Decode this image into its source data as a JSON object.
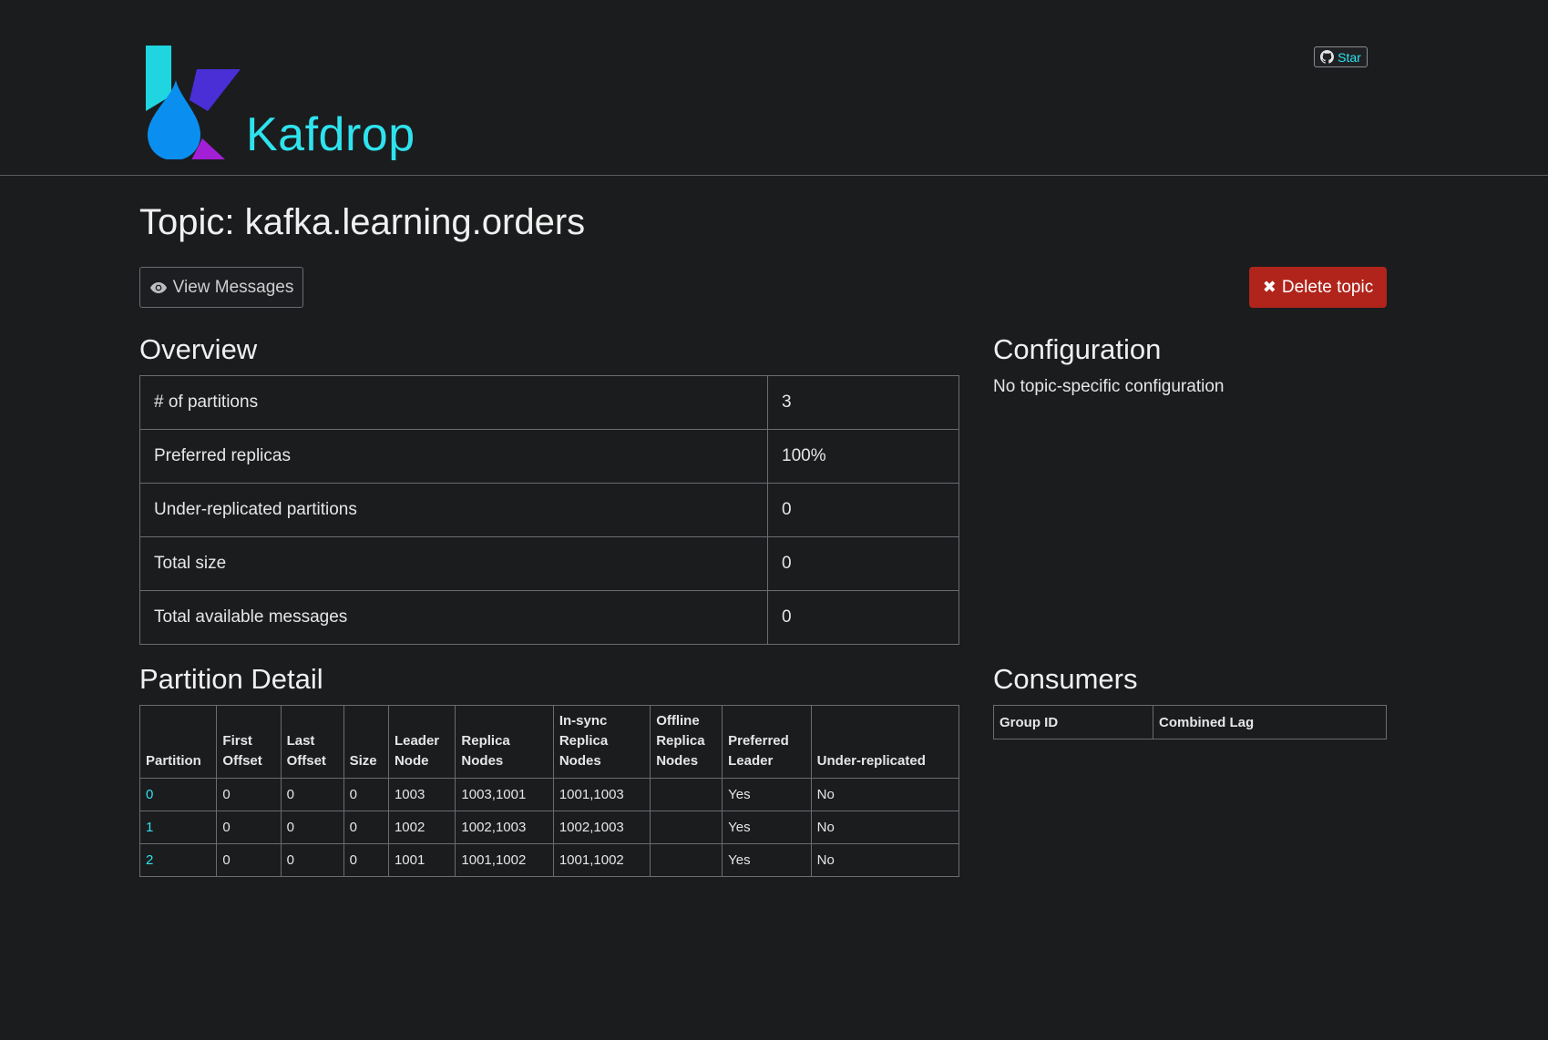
{
  "header": {
    "brand": "Kafdrop",
    "star_label": "Star"
  },
  "page": {
    "title": "Topic: kafka.learning.orders",
    "view_messages_label": "View Messages",
    "delete_topic_label": "Delete topic"
  },
  "overview": {
    "title": "Overview",
    "rows": [
      {
        "label": "# of partitions",
        "value": "3"
      },
      {
        "label": "Preferred replicas",
        "value": "100%"
      },
      {
        "label": "Under-replicated partitions",
        "value": "0"
      },
      {
        "label": "Total size",
        "value": "0"
      },
      {
        "label": "Total available messages",
        "value": "0"
      }
    ]
  },
  "configuration": {
    "title": "Configuration",
    "text": "No topic-specific configuration"
  },
  "partition_detail": {
    "title": "Partition Detail",
    "headers": [
      [
        "Partition"
      ],
      [
        "First",
        "Offset"
      ],
      [
        "Last",
        "Offset"
      ],
      [
        "Size"
      ],
      [
        "Leader",
        "Node"
      ],
      [
        "Replica",
        "Nodes"
      ],
      [
        "In-sync",
        "Replica",
        "Nodes"
      ],
      [
        "Offline",
        "Replica",
        "Nodes"
      ],
      [
        "Preferred",
        "Leader"
      ],
      [
        "Under-replicated"
      ]
    ],
    "rows": [
      [
        "0",
        "0",
        "0",
        "0",
        "1003",
        "1003,1001",
        "1001,1003",
        "",
        "Yes",
        "No"
      ],
      [
        "1",
        "0",
        "0",
        "0",
        "1002",
        "1002,1003",
        "1002,1003",
        "",
        "Yes",
        "No"
      ],
      [
        "2",
        "0",
        "0",
        "0",
        "1001",
        "1001,1002",
        "1001,1002",
        "",
        "Yes",
        "No"
      ]
    ]
  },
  "consumers": {
    "title": "Consumers",
    "headers": [
      "Group ID",
      "Combined Lag"
    ]
  },
  "colors": {
    "background": "#1b1c1e",
    "accent": "#2ee3ee",
    "danger": "#b0241c",
    "border": "#6a6c70"
  }
}
